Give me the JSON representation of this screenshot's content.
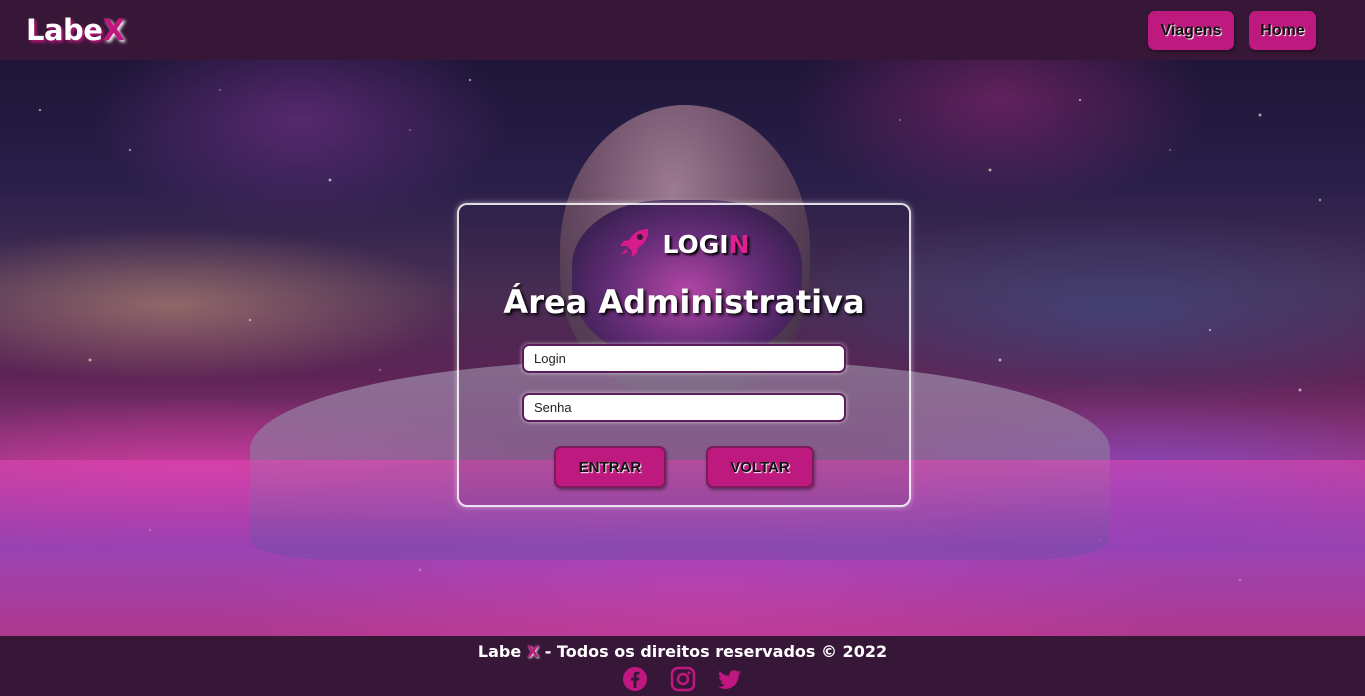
{
  "header": {
    "brand_main": "Labe",
    "brand_accent": "X",
    "nav": {
      "trips_label": "Viagens",
      "home_label": "Home"
    }
  },
  "login": {
    "heading_main": "LOGI",
    "heading_accent": "N",
    "heading_icon": "rocket-icon",
    "area_title": "Área Administrativa",
    "login_placeholder": "Login",
    "password_placeholder": "Senha",
    "enter_label": "ENTRAR",
    "back_label": "VOLTAR"
  },
  "footer": {
    "copyright_prefix": "Labe ",
    "copyright_accent": "X",
    "copyright_suffix": " - Todos os direitos reservados © 2022",
    "social_icons": [
      "facebook-icon",
      "instagram-icon",
      "twitter-icon"
    ]
  },
  "colors": {
    "accent": "#c0167f",
    "bar_background": "#371737",
    "button_background": "#bd197f"
  }
}
